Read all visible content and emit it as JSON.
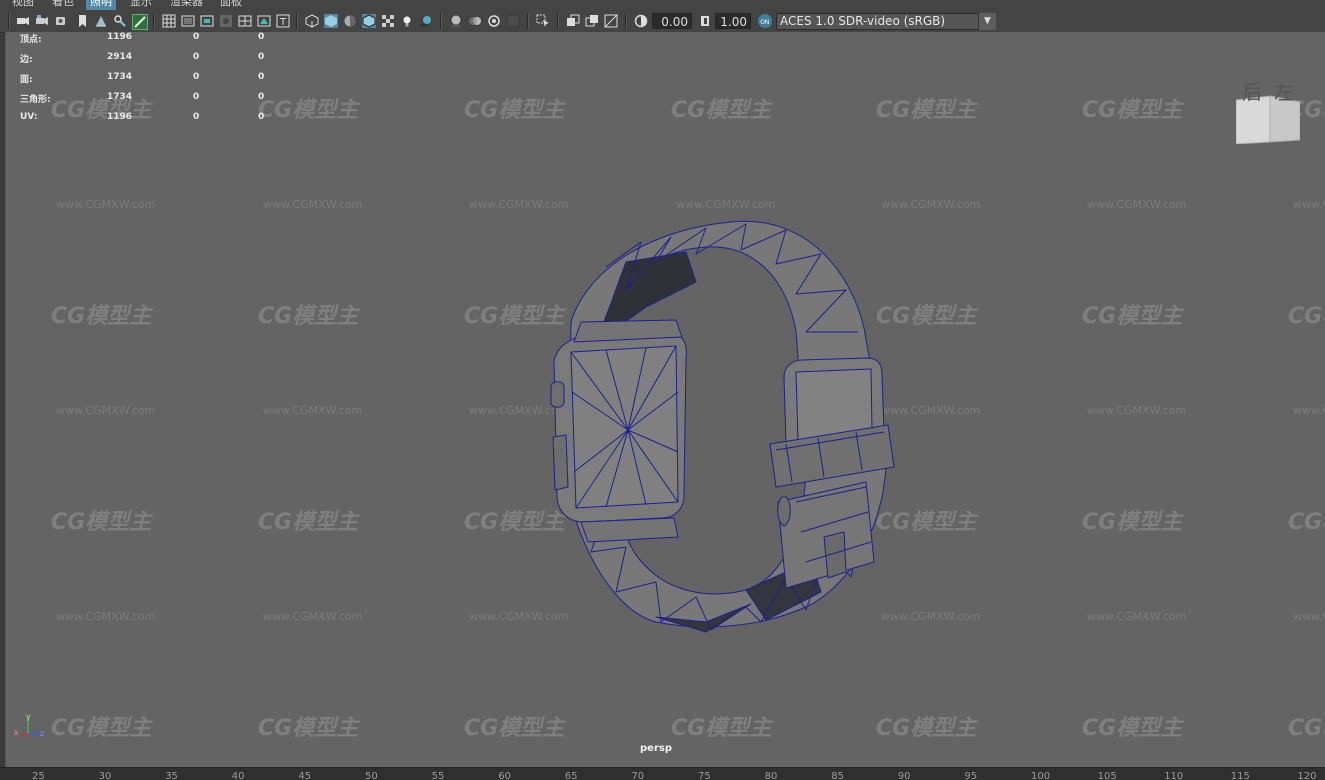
{
  "menu": {
    "items": [
      {
        "label": "视图",
        "active": false
      },
      {
        "label": "着色",
        "active": false
      },
      {
        "label": "照明",
        "active": true
      },
      {
        "label": "显示",
        "active": false
      },
      {
        "label": "渲染器",
        "active": false
      },
      {
        "label": "面板",
        "active": false
      }
    ]
  },
  "toolbar": {
    "exposure_value": "0.00",
    "gamma_value": "1.00",
    "color_space": "ACES 1.0 SDR-video (sRGB)"
  },
  "stats": {
    "rows": [
      {
        "label": "顶点:",
        "v1": "1196",
        "v2": "0",
        "v3": "0"
      },
      {
        "label": "边:",
        "v1": "2914",
        "v2": "0",
        "v3": "0"
      },
      {
        "label": "面:",
        "v1": "1734",
        "v2": "0",
        "v3": "0"
      },
      {
        "label": "三角形:",
        "v1": "1734",
        "v2": "0",
        "v3": "0"
      },
      {
        "label": "UV:",
        "v1": "1196",
        "v2": "0",
        "v3": "0"
      }
    ]
  },
  "viewcube": {
    "back": "后",
    "left": "左"
  },
  "watermark": {
    "logo": "CG模型主",
    "url": "www.CGMXW.com"
  },
  "camera_label": "persp",
  "axis_labels": {
    "x": "x",
    "y": "y",
    "z": "z"
  },
  "timeline": {
    "ticks": [
      "25",
      "30",
      "35",
      "40",
      "45",
      "50",
      "55",
      "60",
      "65",
      "70",
      "75",
      "80",
      "85",
      "90",
      "95",
      "100",
      "105",
      "110",
      "115",
      "120"
    ]
  },
  "colors": {
    "viewport_bg": "#646464",
    "wireframe": "#1a1a8c",
    "mesh_fill": "#787878",
    "menu_active": "#5285a6"
  }
}
